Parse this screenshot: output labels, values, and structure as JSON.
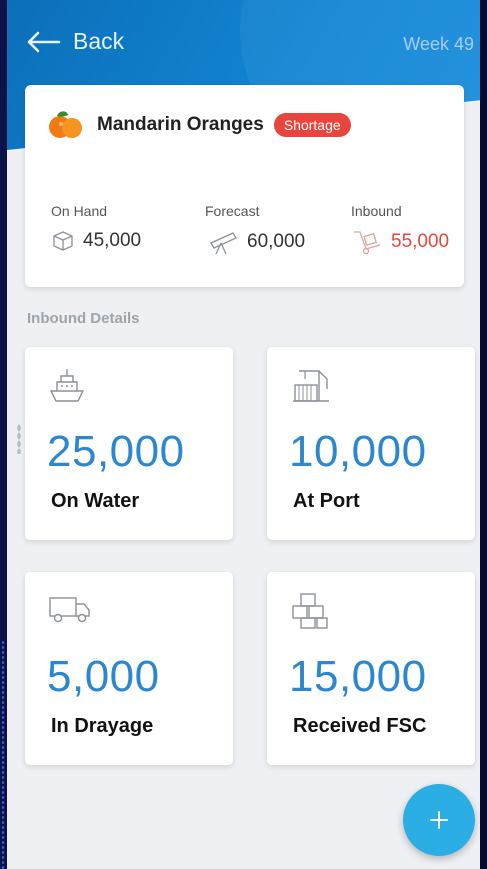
{
  "header": {
    "back_label": "Back",
    "week_label": "Week 49"
  },
  "product": {
    "name": "Mandarin Oranges",
    "status_badge": "Shortage",
    "stats": [
      {
        "label": "On Hand",
        "value": "45,000",
        "icon": "box-icon"
      },
      {
        "label": "Forecast",
        "value": "60,000",
        "icon": "telescope-icon"
      },
      {
        "label": "Inbound",
        "value": "55,000",
        "icon": "hand-truck-icon",
        "highlight": "#e8453c"
      }
    ]
  },
  "section": {
    "title": "Inbound Details"
  },
  "tiles": [
    {
      "value": "25,000",
      "label": "On Water",
      "icon": "ship-icon"
    },
    {
      "value": "10,000",
      "label": "At Port",
      "icon": "port-crane-icon"
    },
    {
      "value": "5,000",
      "label": "In Drayage",
      "icon": "truck-icon"
    },
    {
      "value": "15,000",
      "label": "Received FSC",
      "icon": "stacked-boxes-icon"
    }
  ],
  "fab": {
    "icon": "plus-icon"
  },
  "colors": {
    "header_blue": "#1184d3",
    "accent_blue": "#2d87cf",
    "shortage_red": "#e8453c",
    "fab_blue": "#2aaee4"
  }
}
